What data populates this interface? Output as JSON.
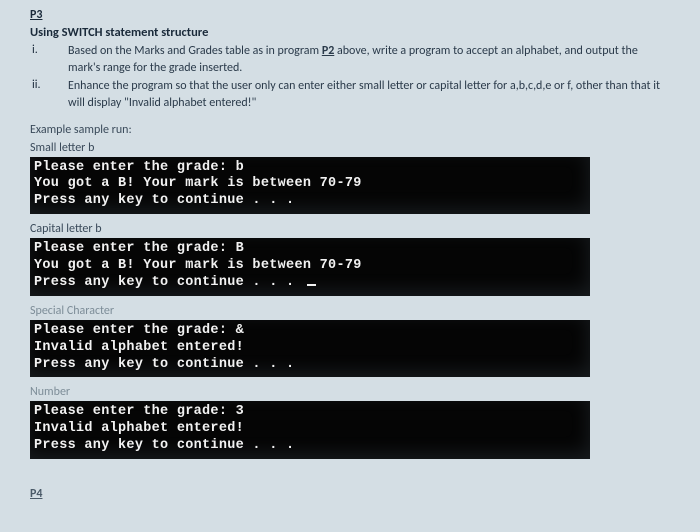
{
  "top_ref": "P3",
  "title": "Using SWITCH statement structure",
  "items": [
    {
      "num": "i.",
      "text_a": "Based on the Marks and Grades table as in program ",
      "p2": "P2",
      "text_b": " above, write a program to accept an alphabet, and output the mark's range for the grade inserted."
    },
    {
      "num": "ii.",
      "text_a": "Enhance the program so that the user only can enter either small letter or capital letter for a,b,c,d,e or f, other than that it will display \"Invalid alphabet entered!\"",
      "p2": "",
      "text_b": ""
    }
  ],
  "example_label": "Example sample run:",
  "runs": [
    {
      "label": "Small letter b",
      "faded": false,
      "lines": "Please enter the grade: b\nYou got a B! Your mark is between 70-79\nPress any key to continue . . .",
      "cursor": false
    },
    {
      "label": "Capital letter b",
      "faded": false,
      "lines": "Please enter the grade: B\nYou got a B! Your mark is between 70-79\nPress any key to continue . . . ",
      "cursor": true
    },
    {
      "label": "Special Character",
      "faded": true,
      "lines": "Please enter the grade: &\nInvalid alphabet entered!\nPress any key to continue . . .",
      "cursor": false
    },
    {
      "label": "Number",
      "faded": true,
      "lines": "Please enter the grade: 3\nInvalid alphabet entered!\nPress any key to continue . . .",
      "cursor": false
    }
  ],
  "footer": "P4"
}
